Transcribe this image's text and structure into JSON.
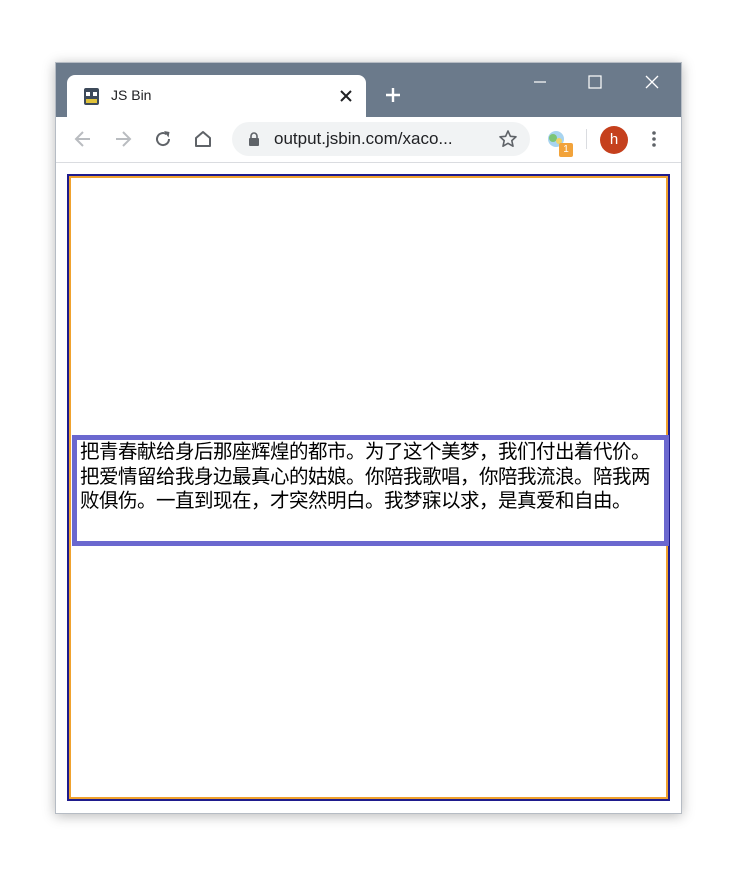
{
  "browser": {
    "tab": {
      "title": "JS Bin",
      "icon": "jsbin-favicon"
    },
    "new_tab_icon": "plus-icon",
    "window_controls": [
      "minimize-icon",
      "maximize-icon",
      "close-icon"
    ],
    "address_bar": {
      "url": "output.jsbin.com/xaco..."
    },
    "extension_badge": "1",
    "profile_initial": "h"
  },
  "content": {
    "paragraph": "把青春献给身后那座辉煌的都市。为了这个美梦，我们付出着代价。把爱情留给我身边最真心的姑娘。你陪我歌唱，你陪我流浪。陪我两败俱伤。一直到现在，才突然明白。我梦寐以求，是真爱和自由。"
  },
  "colors": {
    "titlebar": "#6b7a8b",
    "outer_border": "#1f1b8c",
    "inner_border": "#f0a22e",
    "text_box_border": "#6b68cf",
    "avatar": "#c5401d",
    "badge": "#f2a33a"
  }
}
